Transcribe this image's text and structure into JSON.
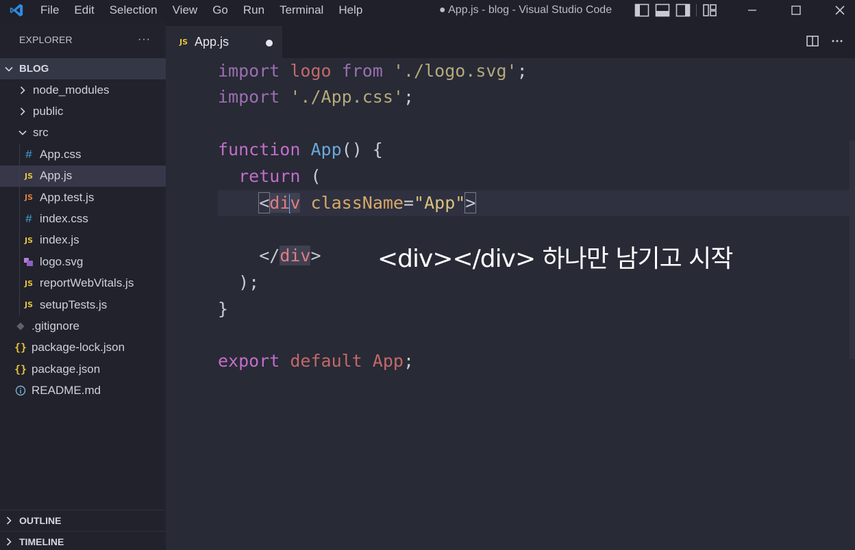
{
  "titlebar": {
    "menu": [
      "File",
      "Edit",
      "Selection",
      "View",
      "Go",
      "Run",
      "Terminal",
      "Help"
    ],
    "window_title": "● App.js - blog - Visual Studio Code"
  },
  "sidebar": {
    "title": "EXPLORER",
    "more": "···",
    "project": "BLOG",
    "items": [
      {
        "label": "node_modules",
        "kind": "folder-collapsed"
      },
      {
        "label": "public",
        "kind": "folder-collapsed"
      },
      {
        "label": "src",
        "kind": "folder-expanded"
      },
      {
        "label": "App.css",
        "kind": "css"
      },
      {
        "label": "App.js",
        "kind": "js",
        "active": true
      },
      {
        "label": "App.test.js",
        "kind": "js"
      },
      {
        "label": "index.css",
        "kind": "css"
      },
      {
        "label": "index.js",
        "kind": "js"
      },
      {
        "label": "logo.svg",
        "kind": "svg"
      },
      {
        "label": "reportWebVitals.js",
        "kind": "js"
      },
      {
        "label": "setupTests.js",
        "kind": "js"
      },
      {
        "label": ".gitignore",
        "kind": "git"
      },
      {
        "label": "package-lock.json",
        "kind": "json"
      },
      {
        "label": "package.json",
        "kind": "json"
      },
      {
        "label": "README.md",
        "kind": "info"
      }
    ],
    "outline": "OUTLINE",
    "timeline": "TIMELINE"
  },
  "tab": {
    "badge": "JS",
    "label": "App.js"
  },
  "icons": {
    "json_badge": "{}",
    "css_badge": "#",
    "js_badge": "JS"
  },
  "code": {
    "l1": {
      "kw": "import",
      "name": "logo",
      "from": "from",
      "str": "'./logo.svg'",
      "end": ";"
    },
    "l2": {
      "kw": "import",
      "str": "'./App.css'",
      "end": ";"
    },
    "l4": {
      "kw": "function",
      "name": "App",
      "rest": "() {"
    },
    "l5": {
      "kw": "return",
      "rest": "("
    },
    "l6": {
      "open": "<",
      "tag_a": "di",
      "tag_b": "v",
      "attr": "className",
      "eq": "=",
      "val": "\"App\"",
      "close": ">"
    },
    "l8": {
      "open": "</",
      "tag": "div",
      "close": ">"
    },
    "l9": {
      "text": ");"
    },
    "l10": {
      "text": "}"
    },
    "l12": {
      "kw": "export",
      "kw2": "default",
      "name": "App",
      "end": ";"
    }
  },
  "caption": "<div></div> 하나만 남기고 시작"
}
